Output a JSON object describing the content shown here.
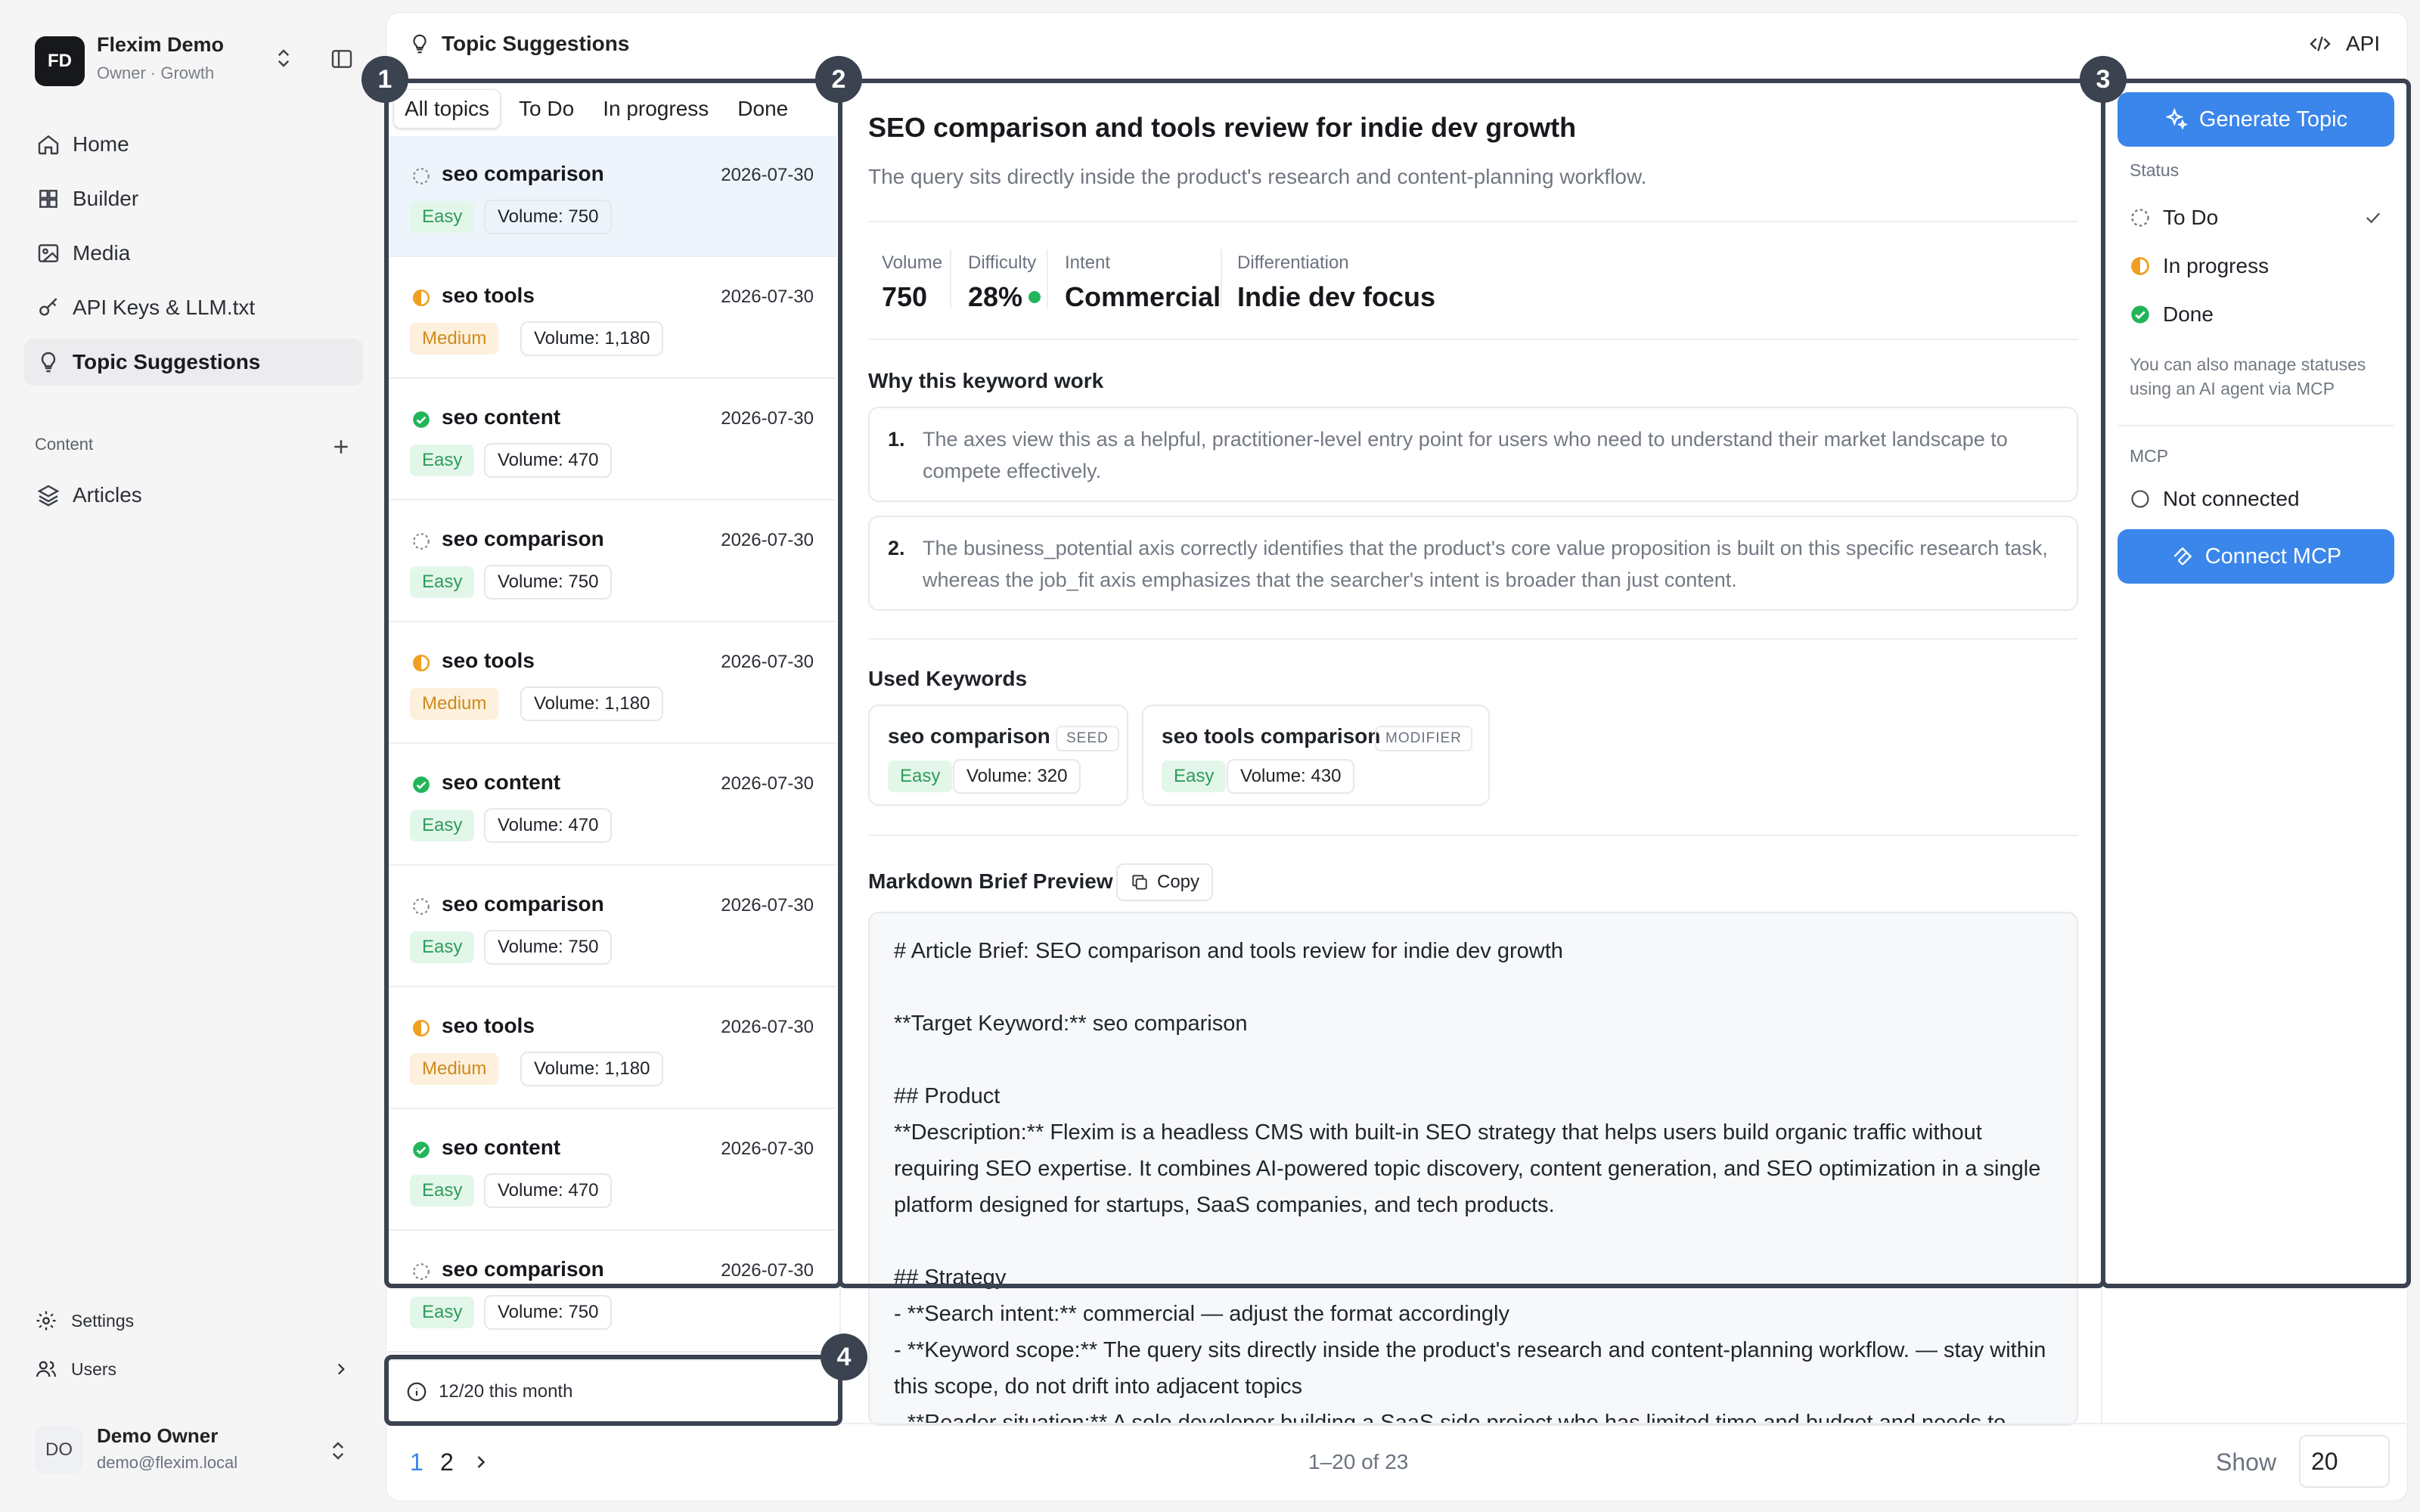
{
  "workspace": {
    "initials": "FD",
    "name": "Flexim Demo",
    "role": "Owner · Growth"
  },
  "nav": [
    {
      "label": "Home",
      "icon": "home-icon"
    },
    {
      "label": "Builder",
      "icon": "grid-icon"
    },
    {
      "label": "Media",
      "icon": "image-icon"
    },
    {
      "label": "API Keys & LLM.txt",
      "icon": "key-icon"
    },
    {
      "label": "Topic Suggestions",
      "icon": "lightbulb-icon",
      "active": true
    }
  ],
  "content_section": {
    "label": "Content",
    "items": [
      {
        "label": "Articles",
        "icon": "layers-icon"
      }
    ]
  },
  "bottom_nav": {
    "settings": "Settings",
    "users": "Users"
  },
  "user": {
    "initials": "DO",
    "name": "Demo Owner",
    "email": "demo@flexim.local"
  },
  "header": {
    "title": "Topic Suggestions",
    "api_label": "API"
  },
  "tabs": [
    "All topics",
    "To Do",
    "In progress",
    "Done"
  ],
  "topics": [
    {
      "keyword": "seo comparison",
      "date": "2026-07-30",
      "status": "todo",
      "difficulty": "Easy",
      "volume": "Volume: 750"
    },
    {
      "keyword": "seo tools",
      "date": "2026-07-30",
      "status": "inprogress",
      "difficulty": "Medium",
      "volume": "Volume: 1,180"
    },
    {
      "keyword": "seo content",
      "date": "2026-07-30",
      "status": "done",
      "difficulty": "Easy",
      "volume": "Volume: 470"
    },
    {
      "keyword": "seo comparison",
      "date": "2026-07-30",
      "status": "todo",
      "difficulty": "Easy",
      "volume": "Volume: 750"
    },
    {
      "keyword": "seo tools",
      "date": "2026-07-30",
      "status": "inprogress",
      "difficulty": "Medium",
      "volume": "Volume: 1,180"
    },
    {
      "keyword": "seo content",
      "date": "2026-07-30",
      "status": "done",
      "difficulty": "Easy",
      "volume": "Volume: 470"
    },
    {
      "keyword": "seo comparison",
      "date": "2026-07-30",
      "status": "todo",
      "difficulty": "Easy",
      "volume": "Volume: 750"
    },
    {
      "keyword": "seo tools",
      "date": "2026-07-30",
      "status": "inprogress",
      "difficulty": "Medium",
      "volume": "Volume: 1,180"
    },
    {
      "keyword": "seo content",
      "date": "2026-07-30",
      "status": "done",
      "difficulty": "Easy",
      "volume": "Volume: 470"
    },
    {
      "keyword": "seo comparison",
      "date": "2026-07-30",
      "status": "todo",
      "difficulty": "Easy",
      "volume": "Volume: 750"
    }
  ],
  "usage": "12/20 this month",
  "detail": {
    "title": "SEO comparison and tools review for indie dev growth",
    "subtitle": "The query sits directly inside the product's research and content-planning workflow.",
    "metrics": {
      "volume_label": "Volume",
      "volume": "750",
      "difficulty_label": "Difficulty",
      "difficulty": "28%",
      "intent_label": "Intent",
      "intent": "Commercial",
      "diff_label": "Differentiation",
      "differentiation": "Indie dev focus"
    },
    "why_heading": "Why this keyword work",
    "reasons": [
      "The axes view this as a helpful, practitioner-level entry point for users who need to understand their market landscape to compete effectively.",
      "The business_potential axis correctly identifies that the product's core value proposition is built on this specific research task, whereas the job_fit axis emphasizes that the searcher's intent is broader than just content."
    ],
    "used_heading": "Used Keywords",
    "used_keywords": [
      {
        "name": "seo comparison",
        "tag": "SEED",
        "difficulty": "Easy",
        "volume": "Volume: 320"
      },
      {
        "name": "seo tools comparison",
        "tag": "MODIFIER",
        "difficulty": "Easy",
        "volume": "Volume: 430"
      }
    ],
    "md_heading": "Markdown Brief Preview",
    "copy_label": "Copy",
    "markdown": "# Article Brief: SEO comparison and tools review for indie dev growth\n\n**Target Keyword:** seo comparison\n\n## Product\n**Description:** Flexim is a headless CMS with built-in SEO strategy that helps users build organic traffic without requiring SEO expertise. It combines AI-powered topic discovery, content generation, and SEO optimization in a single platform designed for startups, SaaS companies, and tech products.\n\n## Strategy\n- **Search intent:** commercial — adjust the format accordingly\n- **Keyword scope:** The query sits directly inside the product's research and content-planning workflow. — stay within this scope, do not drift into adjacent topics\n- **Reader situation:** A solo developer building a SaaS side project who has limited time and budget and needs to"
  },
  "right": {
    "generate_label": "Generate Topic",
    "status_label": "Status",
    "statuses": [
      "To Do",
      "In progress",
      "Done"
    ],
    "status_note": "You can also manage statuses using an AI agent via MCP",
    "mcp_label": "MCP",
    "mcp_state": "Not connected",
    "connect_label": "Connect MCP"
  },
  "pagination": {
    "pages": [
      "1",
      "2"
    ],
    "range": "1–20 of 23",
    "show_label": "Show",
    "page_size": "20"
  },
  "annotations": [
    "1",
    "2",
    "3",
    "4"
  ],
  "colors": {
    "accent": "#3b86ea",
    "easy": "#2f9c5a",
    "medium": "#d08a1a",
    "done": "#22b55a",
    "overlay": "#3b4250"
  }
}
